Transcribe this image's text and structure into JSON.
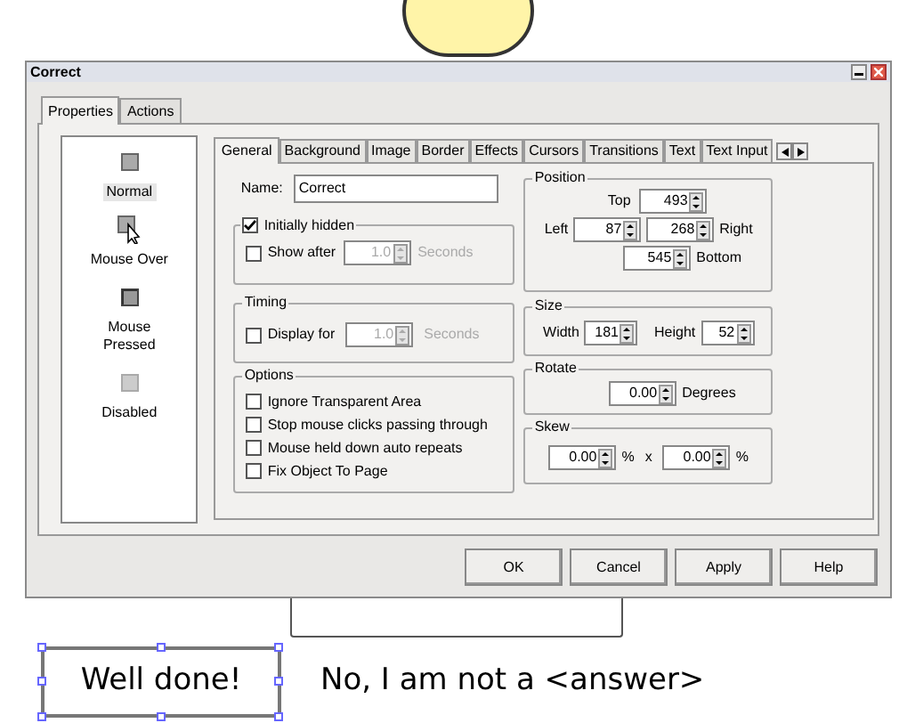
{
  "window": {
    "title": "Correct"
  },
  "outer_tabs": [
    {
      "label": "Properties",
      "selected": true
    },
    {
      "label": "Actions",
      "selected": false
    }
  ],
  "states": [
    {
      "label": "Normal",
      "kind": "normal",
      "selected": true
    },
    {
      "label": "Mouse Over",
      "kind": "over",
      "selected": false
    },
    {
      "label": "Mouse Pressed",
      "kind": "pressed",
      "selected": false
    },
    {
      "label": "Disabled",
      "kind": "disabled",
      "selected": false
    }
  ],
  "inner_tabs": [
    {
      "label": "General",
      "selected": true
    },
    {
      "label": "Background",
      "selected": false
    },
    {
      "label": "Image",
      "selected": false
    },
    {
      "label": "Border",
      "selected": false
    },
    {
      "label": "Effects",
      "selected": false
    },
    {
      "label": "Cursors",
      "selected": false
    },
    {
      "label": "Transitions",
      "selected": false
    },
    {
      "label": "Text",
      "selected": false
    },
    {
      "label": "Text Input",
      "selected": false
    }
  ],
  "general": {
    "name_label": "Name:",
    "name_value": "Correct",
    "initially_hidden": {
      "label": "Initially hidden",
      "checked": true
    },
    "show_after": {
      "label": "Show after",
      "checked": false,
      "value": "1.0",
      "unit": "Seconds",
      "disabled": true
    },
    "timing": {
      "title": "Timing",
      "label": "Display for",
      "checked": false,
      "value": "1.0",
      "unit": "Seconds",
      "disabled": true
    },
    "options": {
      "title": "Options",
      "items": [
        {
          "label": "Ignore Transparent Area",
          "checked": false
        },
        {
          "label": "Stop mouse clicks passing through",
          "checked": false
        },
        {
          "label": "Mouse held down auto repeats",
          "checked": false
        },
        {
          "label": "Fix Object To Page",
          "checked": false
        }
      ]
    },
    "position": {
      "title": "Position",
      "top": {
        "label": "Top",
        "value": "493"
      },
      "left": {
        "label": "Left",
        "value": "87"
      },
      "right": {
        "label": "Right",
        "value": "268"
      },
      "bottom": {
        "label": "Bottom",
        "value": "545"
      }
    },
    "size": {
      "title": "Size",
      "width": {
        "label": "Width",
        "value": "181"
      },
      "height": {
        "label": "Height",
        "value": "52"
      }
    },
    "rotate": {
      "title": "Rotate",
      "value": "0.00",
      "unit": "Degrees"
    },
    "skew": {
      "title": "Skew",
      "x": {
        "value": "0.00",
        "unit": "%"
      },
      "separator": "x",
      "y": {
        "value": "0.00",
        "unit": "%"
      }
    }
  },
  "buttons": [
    "OK",
    "Cancel",
    "Apply",
    "Help"
  ],
  "canvas": {
    "selected_text": "Well done!",
    "text": "No, I am not a <answer>"
  }
}
